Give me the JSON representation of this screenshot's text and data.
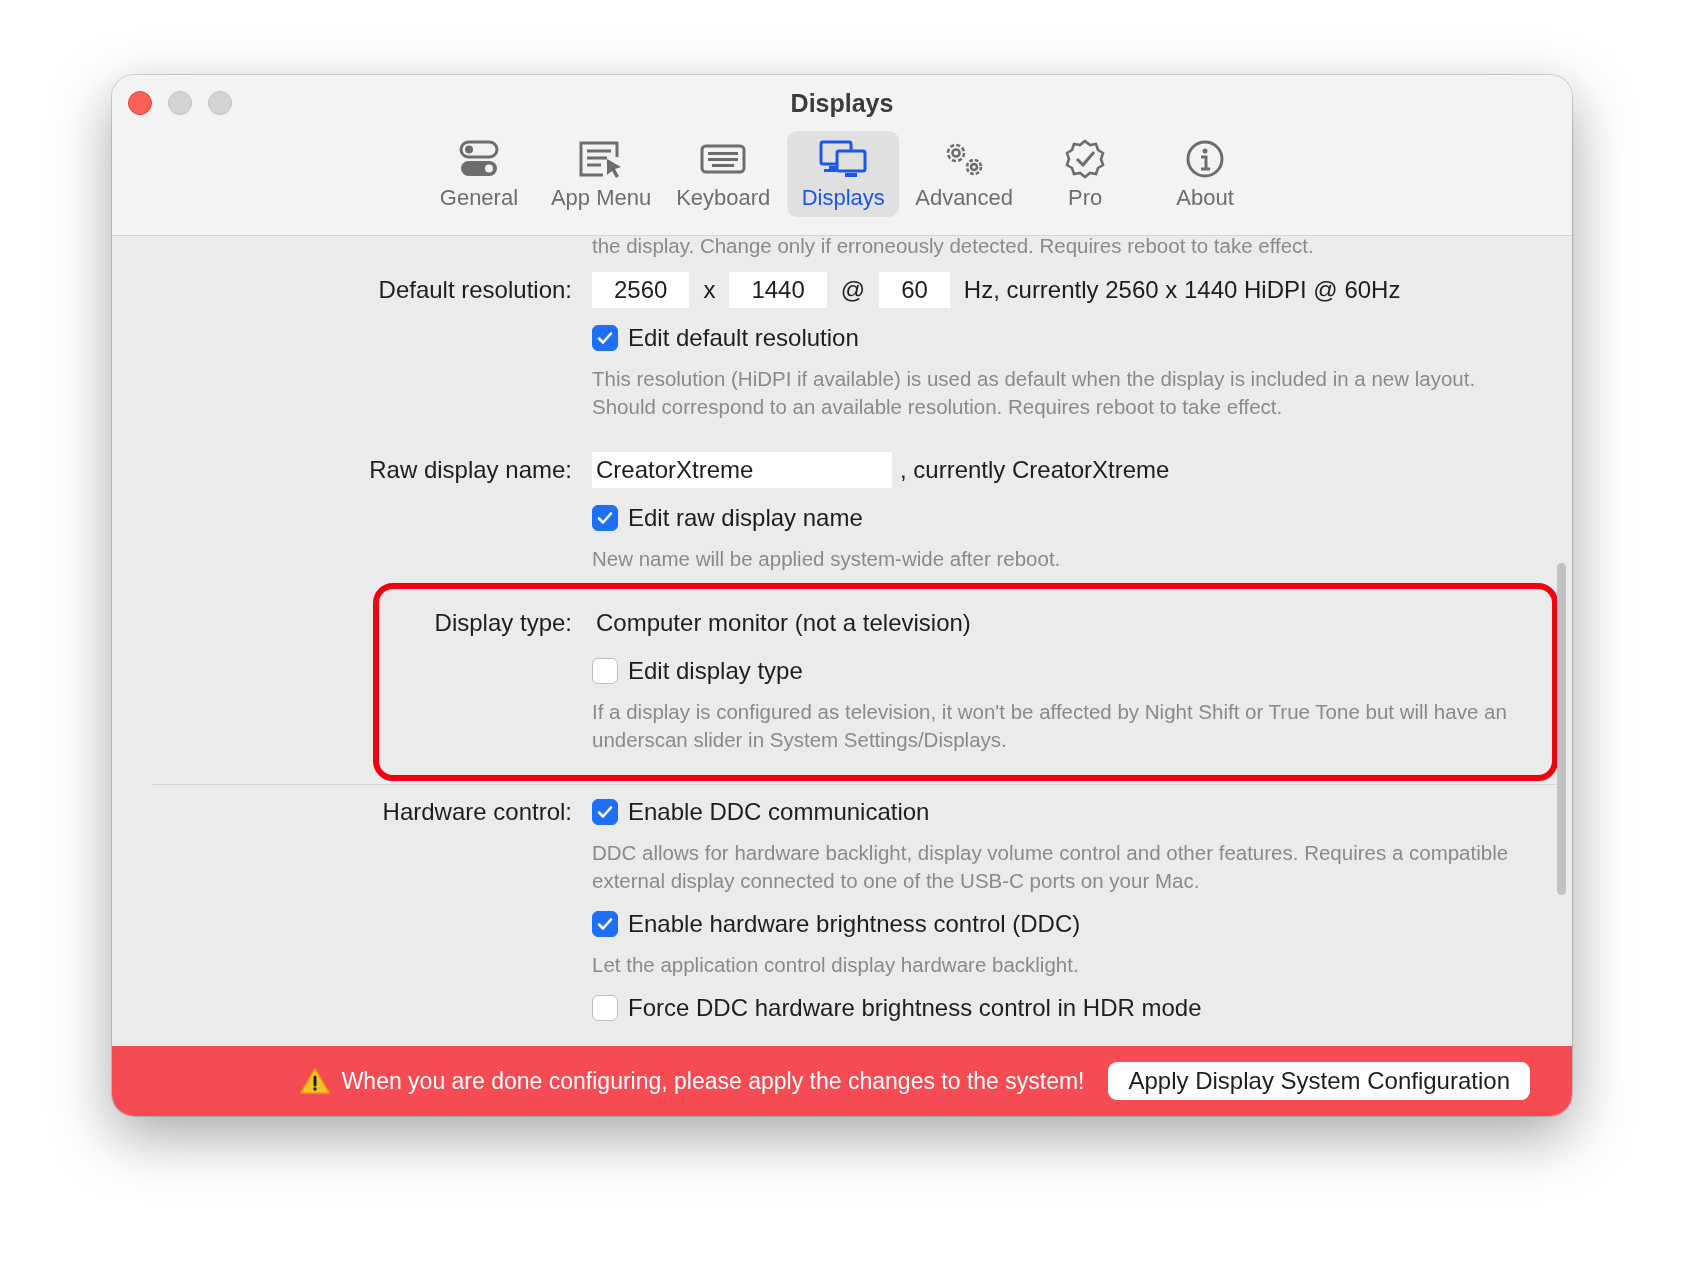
{
  "window": {
    "title": "Displays"
  },
  "toolbar": [
    {
      "label": "General",
      "selected": false
    },
    {
      "label": "App Menu",
      "selected": false
    },
    {
      "label": "Keyboard",
      "selected": false
    },
    {
      "label": "Displays",
      "selected": true
    },
    {
      "label": "Advanced",
      "selected": false
    },
    {
      "label": "Pro",
      "selected": false
    },
    {
      "label": "About",
      "selected": false
    }
  ],
  "top_note": "the display. Change only if erroneously detected. Requires reboot to take effect.",
  "sections": [
    {
      "label": "Default resolution:",
      "highlighted": false,
      "divider_before": false,
      "items": [
        {
          "kind": "values",
          "parts": [
            {
              "kind": "number_field",
              "text": "2560"
            },
            {
              "kind": "text",
              "text": "x"
            },
            {
              "kind": "number_field",
              "text": "1440"
            },
            {
              "kind": "text",
              "text": "@"
            },
            {
              "kind": "number_field",
              "text": "60"
            },
            {
              "kind": "text",
              "text": "Hz, currently 2560 x 1440 HiDPI @ 60Hz"
            }
          ]
        },
        {
          "kind": "checkbox",
          "label": "Edit default resolution",
          "checked": true
        },
        {
          "kind": "note",
          "text": "This resolution (HiDPI if available) is used as default when the display is included in a new layout. Should correspond to an available resolution. Requires reboot to take effect."
        }
      ]
    },
    {
      "label": "Raw display name:",
      "highlighted": false,
      "divider_before": false,
      "items": [
        {
          "kind": "values",
          "parts": [
            {
              "kind": "text_field",
              "text": "CreatorXtreme"
            },
            {
              "kind": "text",
              "text": ", currently CreatorXtreme"
            }
          ]
        },
        {
          "kind": "checkbox",
          "label": "Edit raw display name",
          "checked": true
        },
        {
          "kind": "note",
          "text": "New name will be applied system-wide after reboot."
        }
      ]
    },
    {
      "label": "Display type:",
      "highlighted": true,
      "divider_before": false,
      "items": [
        {
          "kind": "values",
          "parts": [
            {
              "kind": "text",
              "text": "Computer monitor (not a television)"
            }
          ]
        },
        {
          "kind": "checkbox",
          "label": "Edit display type",
          "checked": false
        },
        {
          "kind": "note",
          "text": "If a display is configured as television, it won't be affected by Night Shift or True Tone but will have an underscan slider in System Settings/Displays."
        }
      ]
    },
    {
      "label": "Hardware control:",
      "highlighted": false,
      "divider_before": true,
      "items": [
        {
          "kind": "checkbox",
          "label": "Enable DDC communication",
          "checked": true
        },
        {
          "kind": "note",
          "text": "DDC allows for hardware backlight, display volume control and other features. Requires a compatible external display connected to one of the USB-C ports on your Mac."
        },
        {
          "kind": "checkbox",
          "label": "Enable hardware brightness control (DDC)",
          "checked": true
        },
        {
          "kind": "note",
          "text": "Let the application control display hardware backlight."
        },
        {
          "kind": "checkbox",
          "label": "Force DDC hardware brightness control in HDR mode",
          "checked": false
        }
      ]
    }
  ],
  "banner": {
    "message": "When you are done configuring, please apply the changes to the system!",
    "button": "Apply Display System Configuration"
  }
}
